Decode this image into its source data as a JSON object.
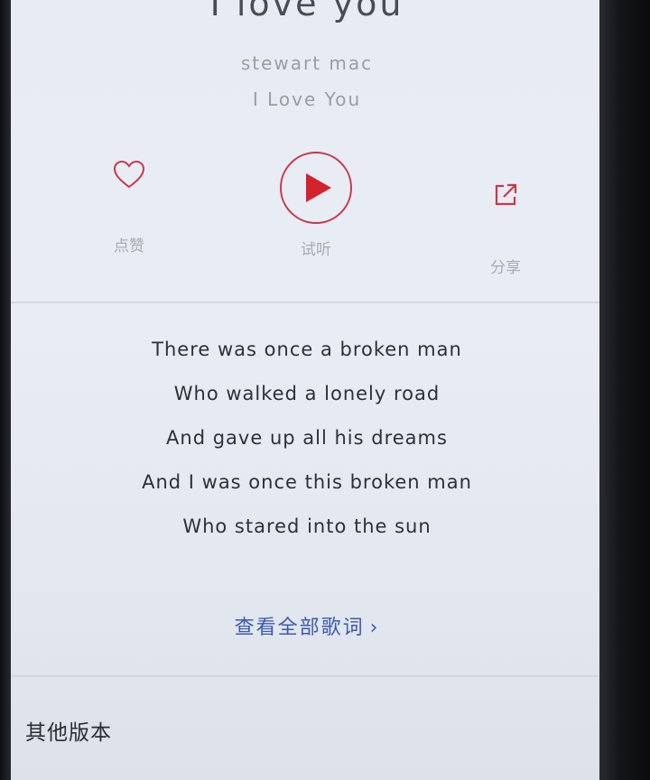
{
  "song": {
    "title": "I love you",
    "artist": "stewart mac",
    "album": "I Love You"
  },
  "actions": {
    "like_label": "点赞",
    "play_label": "试听",
    "share_label": "分享"
  },
  "lyrics": [
    "There was once a broken man",
    "Who walked a lonely road",
    "And gave up all his dreams",
    "And I was once this broken man",
    "Who stared into the sun"
  ],
  "view_all_lyrics": {
    "label": "查看全部歌词",
    "chevron": "›"
  },
  "other_versions": {
    "title": "其他版本"
  },
  "colors": {
    "accent_red": "#d3232f",
    "link_blue": "#3a5ab2"
  },
  "icons": {
    "like": "heart-icon",
    "play": "play-icon",
    "share": "share-icon"
  }
}
